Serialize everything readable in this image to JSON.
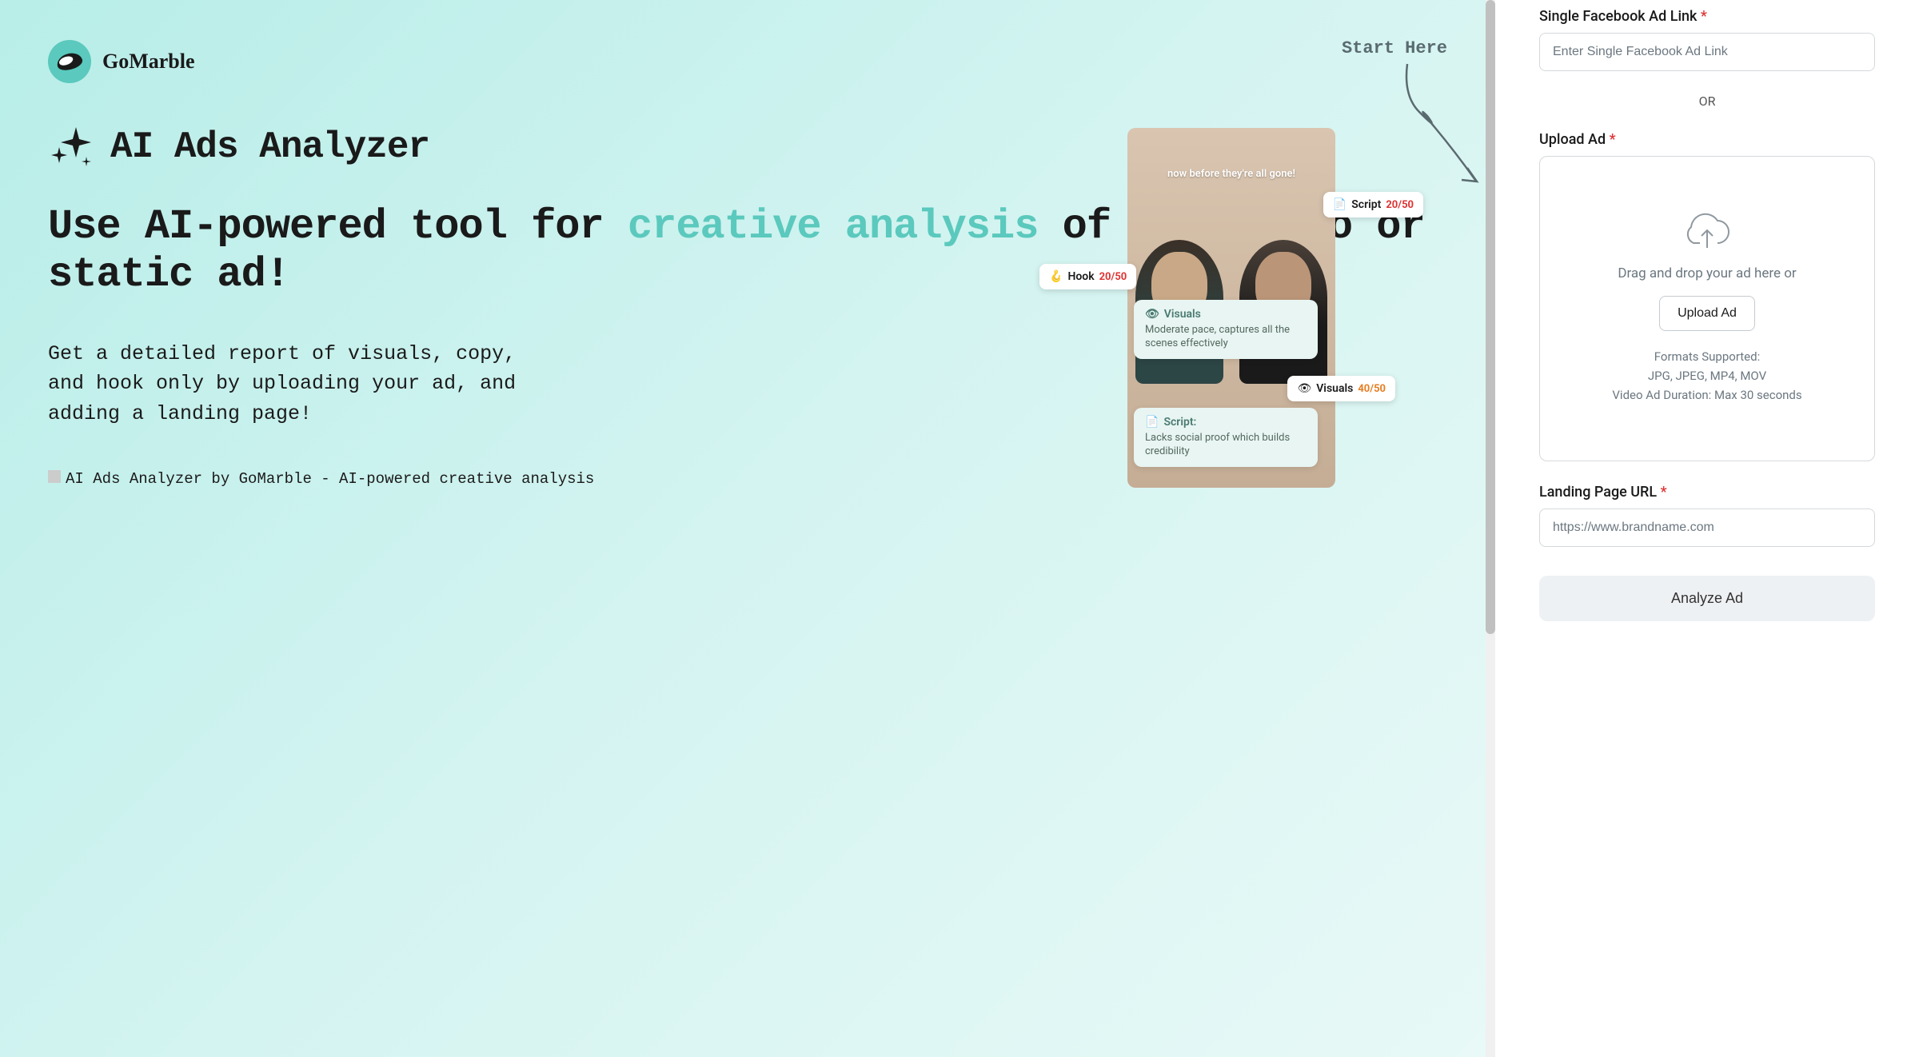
{
  "brand": {
    "name": "GoMarble"
  },
  "hero": {
    "title": "AI Ads Analyzer",
    "heading_part1": "Use AI-powered tool for ",
    "heading_highlight": "creative analysis",
    "heading_part2": " of any video or static ad!",
    "subheading": "Get a detailed report of visuals, copy, and hook only by uploading your ad, and adding a landing page!",
    "start_here": "Start Here",
    "preview_alt": "AI Ads Analyzer by GoMarble - AI-powered creative analysis"
  },
  "preview": {
    "top_caption": "now before they're all gone!",
    "tags": {
      "hook": {
        "label": "Hook",
        "score": "20/50",
        "emoji": "🪝"
      },
      "script": {
        "label": "Script",
        "score": "20/50",
        "emoji": "📄"
      },
      "visuals_small": {
        "label": "Visuals",
        "score": "40/50",
        "emoji": "👁"
      },
      "visuals_big": {
        "title": "Visuals",
        "body": "Moderate pace, captures all the scenes effectively",
        "emoji": "👁"
      },
      "script_big": {
        "title": "Script:",
        "body": "Lacks social proof which builds credibility",
        "emoji": "📄"
      }
    }
  },
  "form": {
    "fb_link_label": "Single Facebook Ad Link",
    "fb_link_placeholder": "Enter Single Facebook Ad Link",
    "or_text": "OR",
    "upload_label": "Upload Ad",
    "upload_drop_text": "Drag and drop your ad here or",
    "upload_button": "Upload Ad",
    "upload_formats": "Formats Supported:",
    "upload_formats_list": "JPG, JPEG, MP4, MOV",
    "upload_duration": "Video Ad Duration: Max 30 seconds",
    "landing_label": "Landing Page URL",
    "landing_placeholder": "https://www.brandname.com",
    "analyze_button": "Analyze Ad"
  }
}
